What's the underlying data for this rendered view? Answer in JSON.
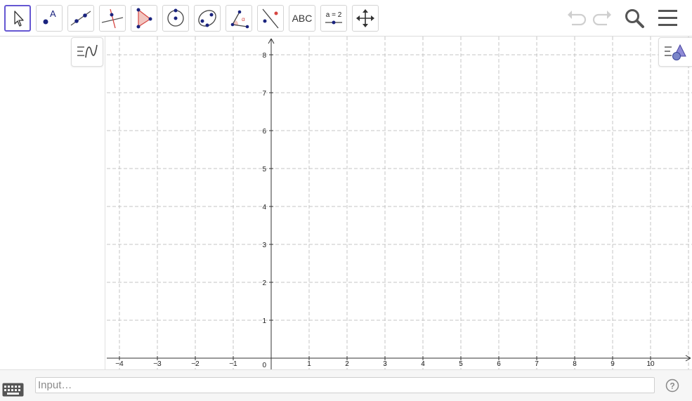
{
  "toolbar": {
    "tools": [
      {
        "id": "move",
        "label": ""
      },
      {
        "id": "point",
        "label": "A"
      },
      {
        "id": "line",
        "label": ""
      },
      {
        "id": "perpendicular",
        "label": ""
      },
      {
        "id": "polygon",
        "label": ""
      },
      {
        "id": "circle",
        "label": ""
      },
      {
        "id": "conic",
        "label": ""
      },
      {
        "id": "angle",
        "label": "α"
      },
      {
        "id": "reflect",
        "label": ""
      },
      {
        "id": "text",
        "label": "ABC"
      },
      {
        "id": "slider",
        "label": "a = 2"
      },
      {
        "id": "move-graphics",
        "label": ""
      }
    ],
    "selected_tool": "move"
  },
  "graphics": {
    "x_ticks": [
      "−4",
      "−3",
      "−2",
      "−1",
      "1",
      "2",
      "3",
      "4",
      "5",
      "6",
      "7",
      "8",
      "9",
      "10"
    ],
    "y_ticks": [
      "1",
      "2",
      "3",
      "4",
      "5",
      "6",
      "7",
      "8"
    ],
    "origin_label": "0",
    "grid": true,
    "grid_style": "dashed"
  },
  "input": {
    "placeholder": "Input…"
  },
  "colors": {
    "accent": "#6557d2",
    "point": "#1a237e",
    "highlight": "#d64541",
    "grid": "#c4c4c4"
  },
  "icons": [
    "undo-icon",
    "redo-icon",
    "search-icon",
    "menu-icon",
    "keyboard-icon",
    "help-icon",
    "algebra-toggle-icon",
    "style-bar-icon"
  ]
}
